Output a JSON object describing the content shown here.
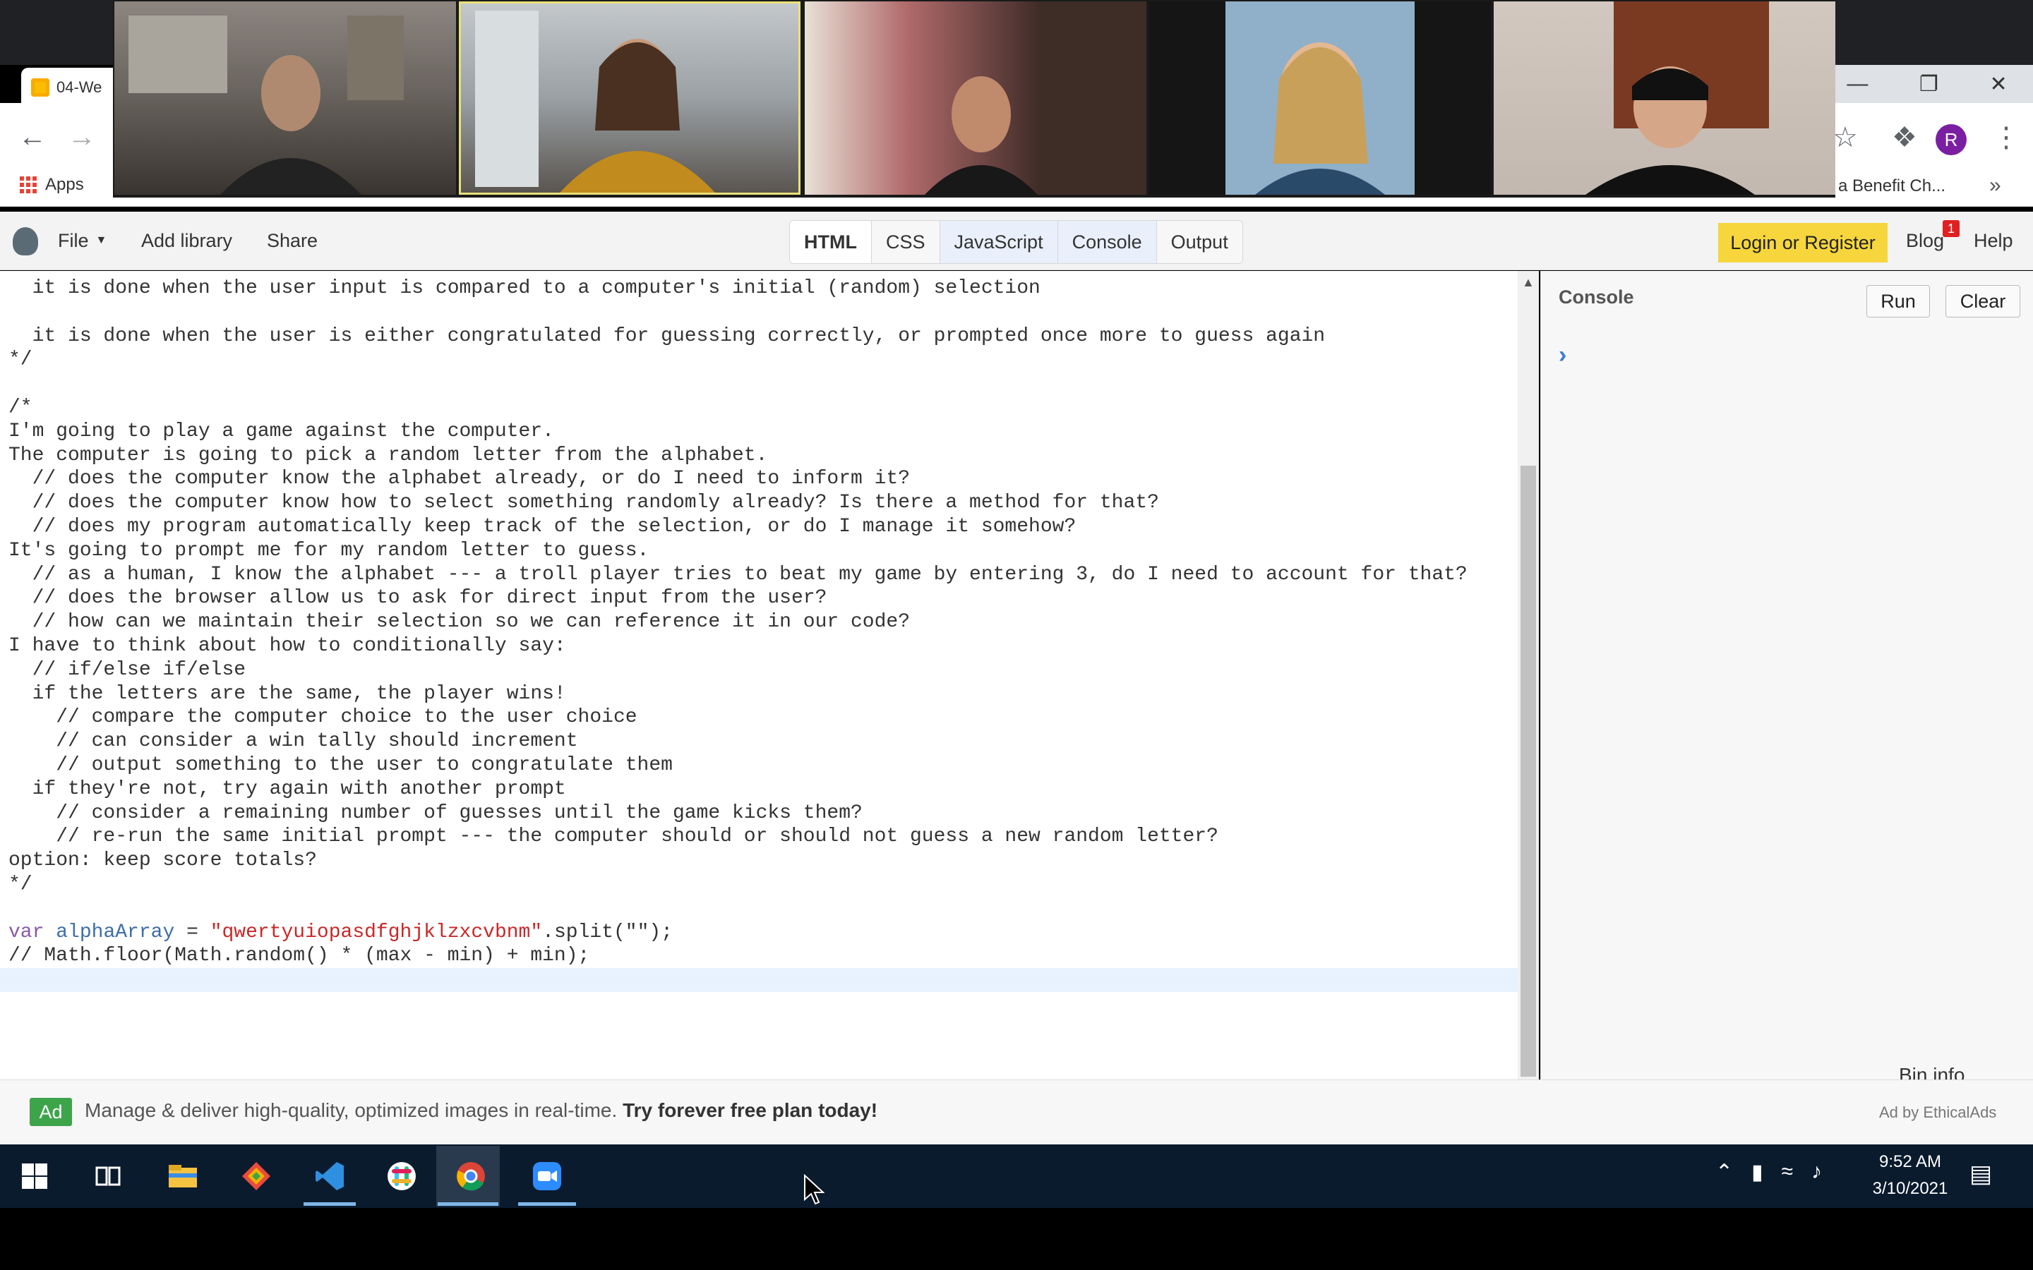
{
  "browser": {
    "tab_title": "04-We",
    "bookmarks": {
      "apps_label": "Apps",
      "right_item": "a Benefit Ch...",
      "more": "»"
    },
    "profile_initial": "R"
  },
  "jsfiddle": {
    "menu": {
      "file": "File",
      "add_library": "Add library",
      "share": "Share"
    },
    "pane_tabs": [
      "HTML",
      "CSS",
      "JavaScript",
      "Console",
      "Output"
    ],
    "login": "Login or Register",
    "blog": "Blog",
    "blog_badge": "1",
    "help": "Help"
  },
  "editor": {
    "lines": [
      "  it is done when the user input is compared to a computer's initial (random) selection",
      "",
      "  it is done when the user is either congratulated for guessing correctly, or prompted once more to guess again",
      "*/",
      "",
      "/*",
      "I'm going to play a game against the computer.",
      "The computer is going to pick a random letter from the alphabet.",
      "  // does the computer know the alphabet already, or do I need to inform it?",
      "  // does the computer know how to select something randomly already? Is there a method for that?",
      "  // does my program automatically keep track of the selection, or do I manage it somehow?",
      "It's going to prompt me for my random letter to guess.",
      "  // as a human, I know the alphabet --- a troll player tries to beat my game by entering 3, do I need to account for that?",
      "  // does the browser allow us to ask for direct input from the user?",
      "  // how can we maintain their selection so we can reference it in our code?",
      "I have to think about how to conditionally say:",
      "  // if/else if/else",
      "  if the letters are the same, the player wins!",
      "    // compare the computer choice to the user choice",
      "    // can consider a win tally should increment",
      "    // output something to the user to congratulate them",
      "  if they're not, try again with another prompt",
      "    // consider a remaining number of guesses until the game kicks them?",
      "    // re-run the same initial prompt --- the computer should or should not guess a new random letter?",
      "option: keep score totals?",
      "*/",
      ""
    ],
    "code_var": "var",
    "code_name": "alphaArray",
    "code_eq": " = ",
    "code_str": "\"qwertyuiopasdfghjklzxcvbnm\"",
    "code_split": ".split(\"\");",
    "code_comment": "// Math.floor(Math.random() * (max - min) + min);"
  },
  "console": {
    "title": "Console",
    "run": "Run",
    "clear": "Clear",
    "bin_info": "Bin info"
  },
  "ad": {
    "badge": "Ad",
    "text": "Manage & deliver high-quality, optimized images in real-time.",
    "cta": "Try forever free plan today!",
    "by": "Ad by EthicalAds"
  },
  "taskbar": {
    "time": "9:52 AM",
    "date": "3/10/2021"
  },
  "colors": {
    "active_speaker_border": "#e8e07a",
    "login_bg": "#f6d63c",
    "ad_green": "#3ea44a",
    "taskbar_bg": "#0b1b2e"
  }
}
